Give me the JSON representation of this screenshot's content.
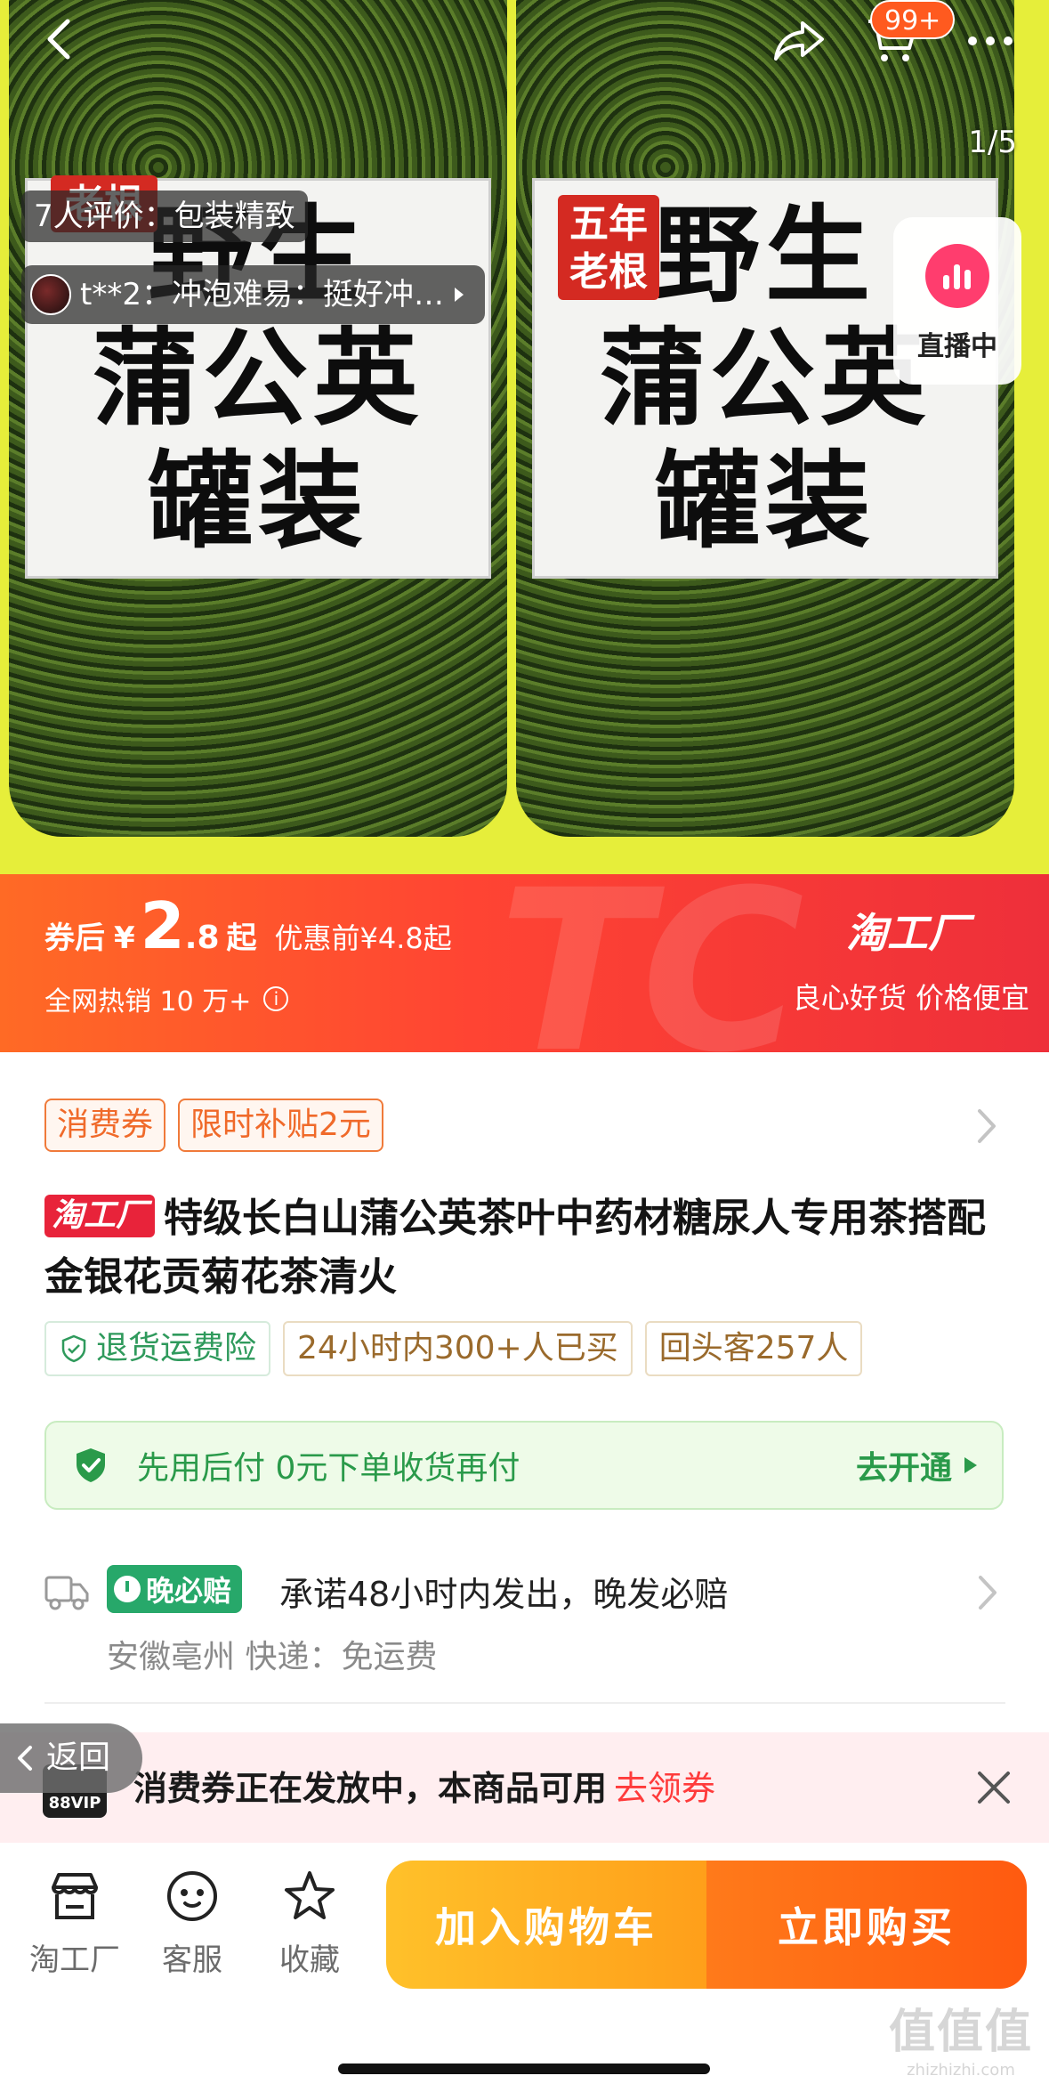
{
  "gallery": {
    "counter": "1/5",
    "jar_left": {
      "lines": [
        "野生",
        "蒲公英",
        "罐装"
      ],
      "badge": "老根"
    },
    "jar_right": {
      "lines": [
        "野生",
        "蒲公英",
        "罐装"
      ],
      "badge_line1": "五年",
      "badge_line2": "老根"
    },
    "review_summary": "7人评价：包装精致",
    "review_quote": "t**2：冲泡难易：挺好冲…",
    "live_label": "直播中",
    "cart_badge": "99+"
  },
  "price": {
    "label": "券后",
    "currency": "¥",
    "integer": "2",
    "decimal": ".8",
    "suffix": "起",
    "before": "优惠前¥4.8起",
    "sold": "全网热销 10 万+",
    "info_symbol": "i",
    "brand": "淘工厂",
    "slogan": "良心好货 价格便宜",
    "watermark": "TC"
  },
  "coupons": [
    "消费券",
    "限时补贴2元"
  ],
  "product": {
    "tag": "淘工厂",
    "title": "特级长白山蒲公英茶叶中药材糖尿人专用茶搭配金银花贡菊花茶清火"
  },
  "features": [
    "退货运费险",
    "24小时内300+人已买",
    "回头客257人"
  ],
  "paylater": {
    "text": "先用后付  0元下单收货再付",
    "action": "去开通"
  },
  "shipping": {
    "badge": "晚必赔",
    "promise": "承诺48小时内发出，晚发必赔",
    "meta": "安徽亳州  快递：免运费"
  },
  "promo": {
    "vip": "88VIP",
    "text": "消费券正在发放中，本商品可用",
    "link": "去领券",
    "return_label": "返回"
  },
  "bottom_nav": {
    "shop": "淘工厂",
    "service": "客服",
    "favorite": "收藏"
  },
  "actions": {
    "add_to_cart": "加入购物车",
    "buy_now": "立即购买"
  },
  "watermark": {
    "big": "值值值",
    "small": "zhizhizhi.com"
  },
  "colors": {
    "accent": "#ff4433",
    "cart_button": "#ffb020",
    "buy_button": "#ff6a15",
    "paylater_green": "#2a9a4a"
  }
}
